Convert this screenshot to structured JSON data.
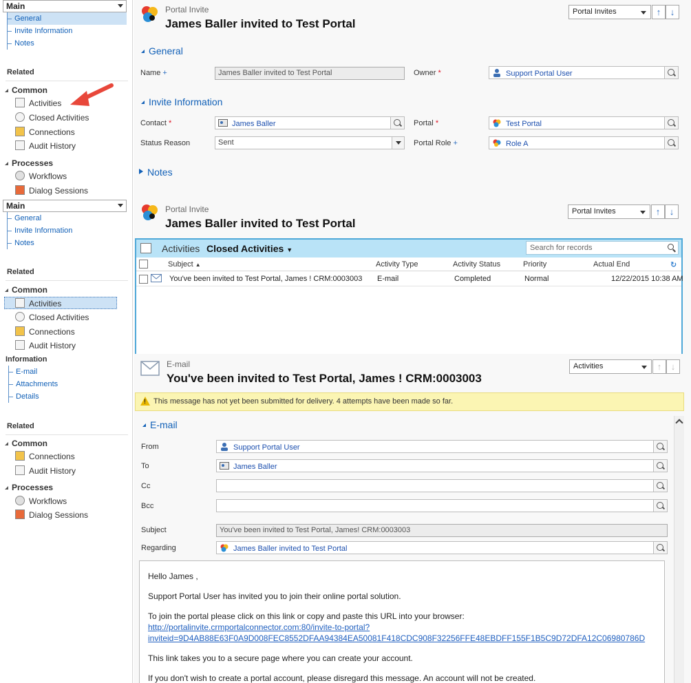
{
  "panel1": {
    "nav_select": "Main",
    "nav_links": [
      "General",
      "Invite Information",
      "Notes"
    ],
    "related_label": "Related",
    "common_label": "Common",
    "common_items": [
      "Activities",
      "Closed Activities",
      "Connections",
      "Audit History"
    ],
    "processes_label": "Processes",
    "process_items": [
      "Workflows",
      "Dialog Sessions"
    ],
    "entity_type": "Portal Invite",
    "record_title": "James Baller invited to Test Portal",
    "view_select": "Portal Invites",
    "section_general": "General",
    "section_invite": "Invite Information",
    "section_notes": "Notes",
    "fields": {
      "name_label": "Name",
      "name_value": "James Baller invited to Test Portal",
      "owner_label": "Owner",
      "owner_value": "Support Portal User",
      "contact_label": "Contact",
      "contact_value": "James Baller",
      "portal_label": "Portal",
      "portal_value": "Test Portal",
      "status_label": "Status Reason",
      "status_value": "Sent",
      "role_label": "Portal Role",
      "role_value": "Role A"
    },
    "required_mark": "*",
    "recommended_mark": "+"
  },
  "panel2": {
    "nav_select": "Main",
    "nav_links": [
      "General",
      "Invite Information",
      "Notes"
    ],
    "related_label": "Related",
    "common_label": "Common",
    "common_items": [
      "Activities",
      "Closed Activities",
      "Connections",
      "Audit History"
    ],
    "entity_type": "Portal Invite",
    "record_title": "James Baller invited to Test Portal",
    "view_select": "Portal Invites",
    "grid": {
      "tab_activities": "Activities",
      "tab_closed": "Closed Activities",
      "search_placeholder": "Search for records",
      "columns": [
        "Subject",
        "Activity Type",
        "Activity Status",
        "Priority",
        "Actual End"
      ],
      "row": {
        "subject": "You've been invited to Test Portal, James ! CRM:0003003",
        "type": "E-mail",
        "status": "Completed",
        "priority": "Normal",
        "actual_end": "12/22/2015 10:38 AM"
      }
    }
  },
  "panel3": {
    "info_label": "Information",
    "nav_links": [
      "E-mail",
      "Attachments",
      "Details"
    ],
    "related_label": "Related",
    "common_label": "Common",
    "common_items": [
      "Connections",
      "Audit History"
    ],
    "processes_label": "Processes",
    "process_items": [
      "Workflows",
      "Dialog Sessions"
    ],
    "entity_type": "E-mail",
    "record_title": "You've been invited to Test Portal, James ! CRM:0003003",
    "view_select": "Activities",
    "warning": "This message has not yet been submitted for delivery. 4 attempts have been made so far.",
    "section_email": "E-mail",
    "fields": {
      "from_label": "From",
      "from_value": "Support Portal User",
      "to_label": "To",
      "to_value": "James Baller",
      "cc_label": "Cc",
      "bcc_label": "Bcc",
      "subject_label": "Subject",
      "subject_value": "You've been invited to Test Portal, James! CRM:0003003",
      "regarding_label": "Regarding",
      "regarding_value": "James Baller invited to Test Portal"
    },
    "body": {
      "greeting": "Hello James ,",
      "line1": "Support Portal User has invited you to join their online portal solution.",
      "line2": "To join the portal please click on this link or copy and paste this URL into your browser:",
      "link1": "http://portalinvite.crmportalconnector.com:80/invite-to-portal?",
      "link2": "inviteid=9D4AB88E63F0A9D008FEC8552DFAA94384EA50081F418CDC908F32256FFE48EBDFF155F1B5C9D72DFA12C06980786D",
      "line3": "This link takes you to a secure page where you can create your account.",
      "line4": "If you don't wish to create a portal account, please disregard this message. An account will not be created."
    }
  },
  "colors": {
    "link_blue": "#1160b7",
    "grid_header": "#b9e3f7",
    "warning_bg": "#fbf5b3",
    "annotation_arrow": "#e8473a"
  },
  "icons": [
    "portal-logo-icon",
    "activities-icon",
    "closed-activities-icon",
    "connections-icon",
    "audit-history-icon",
    "workflows-icon",
    "dialog-sessions-icon",
    "email-icon",
    "warning-icon",
    "lookup-icon",
    "user-icon",
    "contact-card-icon",
    "refresh-icon"
  ]
}
